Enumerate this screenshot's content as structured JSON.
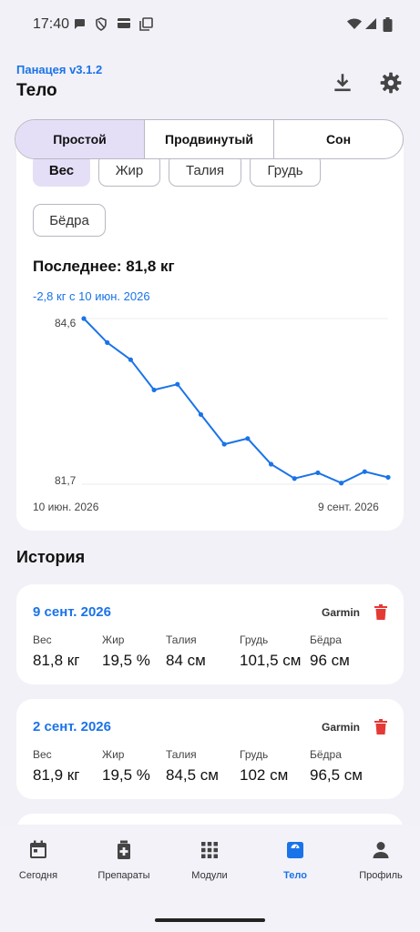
{
  "status_bar": {
    "time": "17:40"
  },
  "header": {
    "app_version": "Панацея v3.1.2",
    "title": "Тело"
  },
  "tabs": [
    {
      "label": "Простой",
      "active": true
    },
    {
      "label": "Продвинутый",
      "active": false
    },
    {
      "label": "Сон",
      "active": false
    }
  ],
  "metric_chips": [
    {
      "label": "Вес",
      "selected": true
    },
    {
      "label": "Жир",
      "selected": false
    },
    {
      "label": "Талия",
      "selected": false
    },
    {
      "label": "Грудь",
      "selected": false
    },
    {
      "label": "Бёдра",
      "selected": false
    }
  ],
  "summary": {
    "latest": "Последнее: 81,8 кг",
    "delta": "-2,8 кг с 10 июн. 2026"
  },
  "chart_data": {
    "type": "line",
    "ytick_labels": [
      "84,6",
      "81,7"
    ],
    "xtick_labels": [
      "10 июн. 2026",
      "9 сент. 2026"
    ],
    "ylim": [
      81.7,
      84.6
    ],
    "series": [
      {
        "values": [
          84.6,
          84.18,
          83.88,
          83.35,
          83.45,
          82.92,
          82.4,
          82.5,
          82.05,
          81.8,
          81.9,
          81.72,
          81.92,
          81.82
        ]
      }
    ],
    "grid": "horizontal",
    "color": "#1a73e8"
  },
  "history": {
    "title": "История",
    "entries": [
      {
        "date": "9 сент. 2026",
        "source": "Garmin",
        "metrics": [
          {
            "label": "Вес",
            "value": "81,8 кг"
          },
          {
            "label": "Жир",
            "value": "19,5 %"
          },
          {
            "label": "Талия",
            "value": "84 см"
          },
          {
            "label": "Грудь",
            "value": "101,5 см"
          },
          {
            "label": "Бёдра",
            "value": "96 см"
          }
        ]
      },
      {
        "date": "2 сент. 2026",
        "source": "Garmin",
        "metrics": [
          {
            "label": "Вес",
            "value": "81,9 кг"
          },
          {
            "label": "Жир",
            "value": "19,5 %"
          },
          {
            "label": "Талия",
            "value": "84,5 см"
          },
          {
            "label": "Грудь",
            "value": "102 см"
          },
          {
            "label": "Бёдра",
            "value": "96,5 см"
          }
        ]
      }
    ]
  },
  "bottom_nav": [
    {
      "label": "Сегодня",
      "icon": "calendar-icon",
      "active": false
    },
    {
      "label": "Препараты",
      "icon": "medicine-icon",
      "active": false
    },
    {
      "label": "Модули",
      "icon": "grid-icon",
      "active": false
    },
    {
      "label": "Тело",
      "icon": "scale-icon",
      "active": true
    },
    {
      "label": "Профиль",
      "icon": "person-icon",
      "active": false
    }
  ],
  "colors": {
    "accent": "#1a73e8",
    "selected_bg": "#e4dff6",
    "delete": "#e53935"
  }
}
